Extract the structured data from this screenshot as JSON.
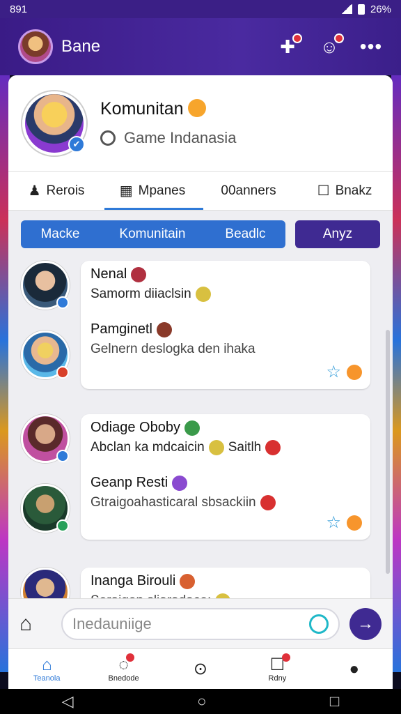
{
  "status_bar": {
    "time": "891",
    "battery": "26%"
  },
  "app_bar": {
    "title": "Bane"
  },
  "profile": {
    "name": "Komunitan",
    "subtitle": "Game Indanasia"
  },
  "tabs": [
    {
      "label": "Rerois",
      "icon": "puzzle-icon"
    },
    {
      "label": "Mpanes",
      "icon": "grid-icon"
    },
    {
      "label": "00anners",
      "icon": ""
    },
    {
      "label": "Bnakz",
      "icon": "page-icon"
    }
  ],
  "filters": {
    "segments": [
      "Macke",
      "Komunitain",
      "Beadlc"
    ],
    "extra": "Anyz"
  },
  "feed": [
    {
      "messages": [
        {
          "name": "Nenal",
          "text": "Samorm diiaclsin",
          "avatar_color": "#33506a"
        },
        {
          "name": "Pamginetl",
          "text": "Gelnern deslogka den ihaka",
          "avatar_color": "#2c7ab8"
        }
      ]
    },
    {
      "messages": [
        {
          "name": "Odiage Oboby",
          "text": "Abclan ka mdcaicin",
          "text2": "Saitlh",
          "avatar_color": "#c0508a"
        },
        {
          "name": "Geanp Resti",
          "text": "Gtraigoahasticaral sbsackiin",
          "avatar_color": "#2a7a4a"
        }
      ]
    },
    {
      "messages": [
        {
          "name": "Inanga Birouli",
          "text": "Seraigen sliaradace:",
          "avatar_color": "#3a3ab0"
        }
      ]
    }
  ],
  "composer": {
    "placeholder": "Inedauniige"
  },
  "bottom_nav": [
    {
      "label": "Teanola",
      "icon": "home-icon",
      "active": true
    },
    {
      "label": "Bnedode",
      "icon": "chat-icon",
      "active": false
    },
    {
      "label": "",
      "icon": "help-icon",
      "active": false
    },
    {
      "label": "Rdny",
      "icon": "notification-icon",
      "active": false
    },
    {
      "label": "",
      "icon": "profile-icon",
      "active": false
    }
  ],
  "colors": {
    "app_bar": "#3a1b86",
    "accent": "#2f7ad8",
    "segment": "#2f6fd0",
    "extra_button": "#3f2a92"
  }
}
